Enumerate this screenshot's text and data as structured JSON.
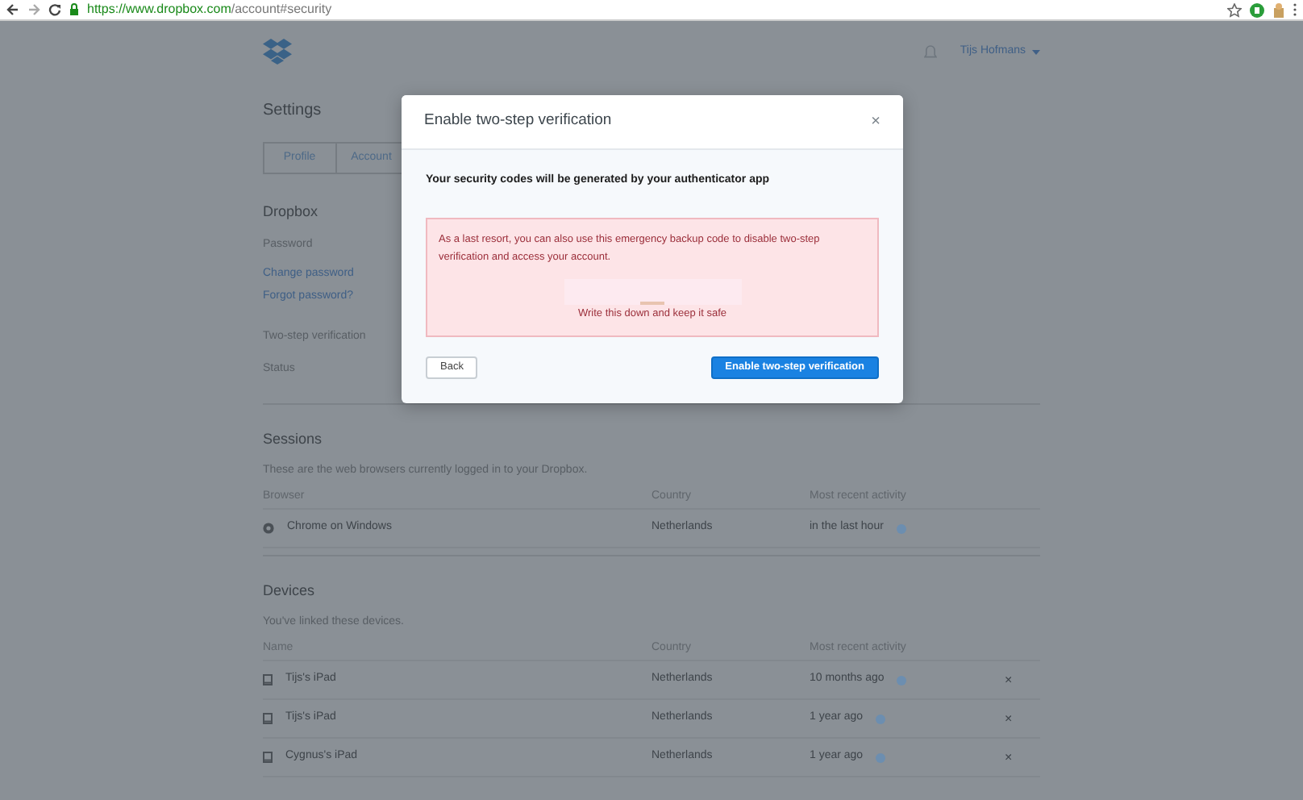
{
  "browser": {
    "url_host": "https://www.dropbox.com",
    "url_path": "/account#security"
  },
  "header": {
    "user": "Tijs Hofmans"
  },
  "settings": {
    "title": "Settings",
    "tabs": [
      {
        "label": "Profile",
        "selected": false
      },
      {
        "label": "Account",
        "selected": false
      }
    ]
  },
  "dropbox_section": {
    "heading": "Dropbox",
    "password_label": "Password",
    "links": [
      "Change password",
      "Forgot password?"
    ],
    "two_step_label": "Two-step verification",
    "status_label": "Status"
  },
  "sessions": {
    "heading": "Sessions",
    "description": "These are the web browsers currently logged in to your Dropbox.",
    "columns": [
      "Browser",
      "Country",
      "Most recent activity"
    ],
    "rows": [
      {
        "name": "Chrome on Windows",
        "country": "Netherlands",
        "activity": "in the last hour"
      }
    ]
  },
  "devices": {
    "heading": "Devices",
    "description": "You've linked these devices.",
    "columns": [
      "Name",
      "Country",
      "Most recent activity"
    ],
    "rows": [
      {
        "name": "Tijs's iPad",
        "country": "Netherlands",
        "activity": "10 months ago",
        "remove": "×"
      },
      {
        "name": "Tijs's iPad",
        "country": "Netherlands",
        "activity": "1 year ago",
        "remove": "×"
      },
      {
        "name": "Cygnus's iPad",
        "country": "Netherlands",
        "activity": "1 year ago",
        "remove": "×"
      }
    ]
  },
  "modal": {
    "title": "Enable two-step verification",
    "close": "×",
    "subtitle": "Your security codes will be generated by your authenticator app",
    "alert": "As a last resort, you can also use this emergency backup code to disable two-step verification and access your account.",
    "code_hint": "Write this down and keep it safe",
    "back": "Back",
    "confirm": "Enable two-step verification"
  }
}
